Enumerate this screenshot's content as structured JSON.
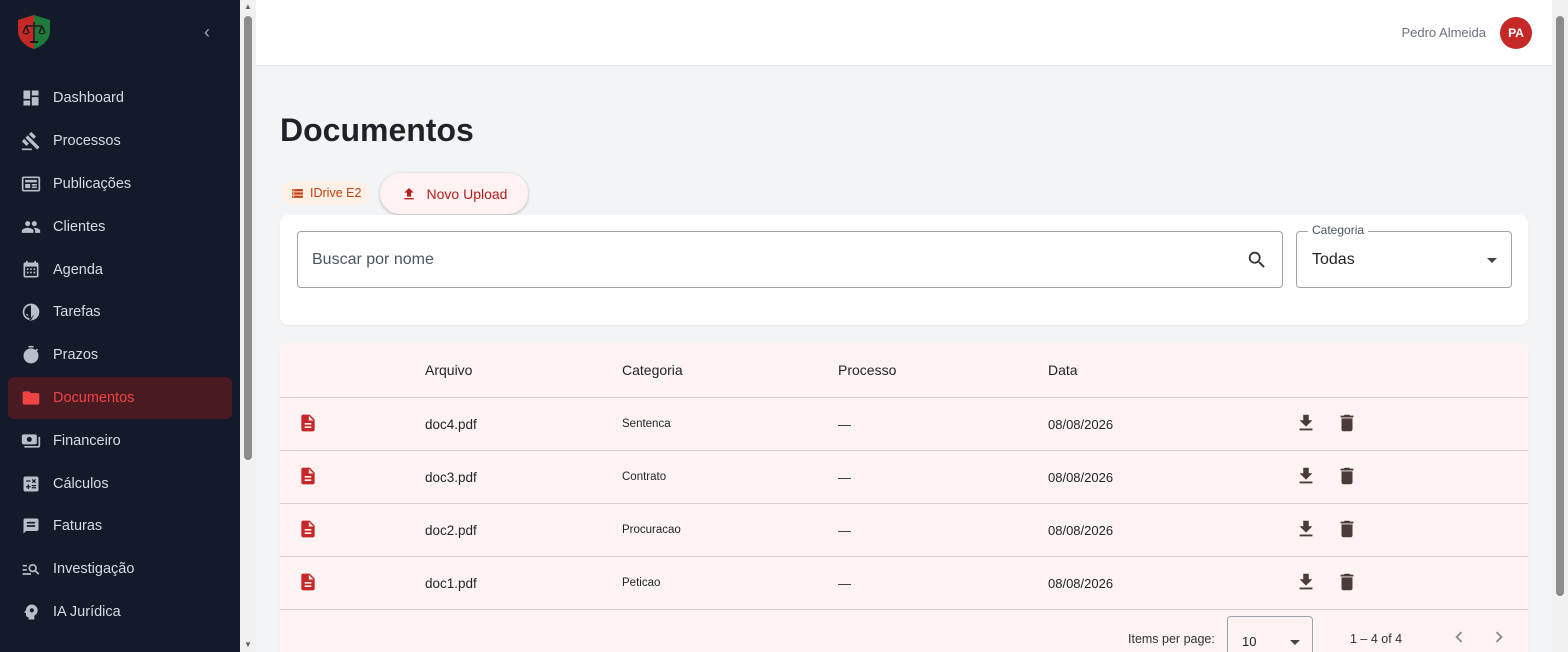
{
  "sidebar": {
    "logo_icon": "shield-scales-logo",
    "collapse_icon": "chevron-left-icon",
    "items": [
      {
        "label": "Dashboard",
        "icon": "dashboard-icon"
      },
      {
        "label": "Processos",
        "icon": "gavel-icon"
      },
      {
        "label": "Publicações",
        "icon": "newspaper-icon"
      },
      {
        "label": "Clientes",
        "icon": "people-icon"
      },
      {
        "label": "Agenda",
        "icon": "calendar-icon"
      },
      {
        "label": "Tarefas",
        "icon": "check-circle-icon"
      },
      {
        "label": "Prazos",
        "icon": "timer-icon"
      },
      {
        "label": "Documentos",
        "icon": "folder-icon",
        "active": true
      },
      {
        "label": "Financeiro",
        "icon": "money-icon"
      },
      {
        "label": "Cálculos",
        "icon": "calculate-icon"
      },
      {
        "label": "Faturas",
        "icon": "receipt-icon"
      },
      {
        "label": "Investigação",
        "icon": "manage-search-icon"
      },
      {
        "label": "IA Jurídica",
        "icon": "psychology-icon"
      }
    ]
  },
  "topbar": {
    "user_name": "Pedro Almeida",
    "avatar_initials": "PA"
  },
  "main": {
    "title": "Documentos",
    "storage_badge": "IDrive E2",
    "upload_button": "Novo Upload",
    "search": {
      "placeholder": "Buscar por nome",
      "value": ""
    },
    "category_filter": {
      "label": "Categoria",
      "value": "Todas"
    },
    "table": {
      "headers": [
        "Arquivo",
        "Categoria",
        "Processo",
        "Data"
      ],
      "rows": [
        {
          "name": "doc4.pdf",
          "category": "Sentenca",
          "process": "—",
          "date": "08/08/2026"
        },
        {
          "name": "doc3.pdf",
          "category": "Contrato",
          "process": "—",
          "date": "08/08/2026"
        },
        {
          "name": "doc2.pdf",
          "category": "Procuracao",
          "process": "—",
          "date": "08/08/2026"
        },
        {
          "name": "doc1.pdf",
          "category": "Peticao",
          "process": "—",
          "date": "08/08/2026"
        }
      ]
    },
    "pagination": {
      "items_per_page_label": "Items per page:",
      "items_per_page": "10",
      "range": "1 – 4 of 4"
    }
  },
  "colors": {
    "sidebar_bg": "#131a2a",
    "accent": "#c62828",
    "active_item_bg": "#4a1a22",
    "active_text": "#ef4444",
    "table_bg": "#fdf3f2"
  }
}
